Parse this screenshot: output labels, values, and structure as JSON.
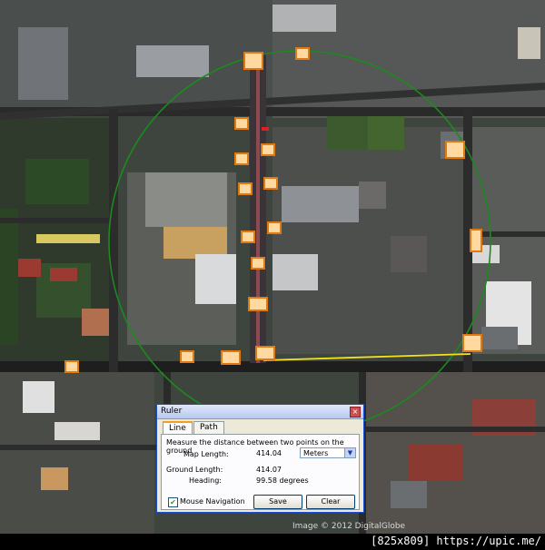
{
  "map": {
    "credit": "Image © 2012 DigitalGlobe",
    "circle_color": "#1c8a1c",
    "measure_line_color": "#f2e21a",
    "pin_color": "#ffd9a0",
    "pin_border_color": "#e07a10"
  },
  "watermark": {
    "text": "[825x809] https://upic.me/"
  },
  "ruler": {
    "title": "Ruler",
    "close_icon": "close-icon",
    "tabs": [
      "Line",
      "Path"
    ],
    "active_tab": "Line",
    "description": "Measure the distance between two points on the ground",
    "map_length_label": "Map Length:",
    "map_length_value": "414.04",
    "unit": "Meters",
    "ground_length_label": "Ground Length:",
    "ground_length_value": "414.07",
    "heading_label": "Heading:",
    "heading_value": "99.58 degrees",
    "mouse_navigation_label": "Mouse Navigation",
    "mouse_navigation_checked": true,
    "save_label": "Save",
    "clear_label": "Clear"
  }
}
